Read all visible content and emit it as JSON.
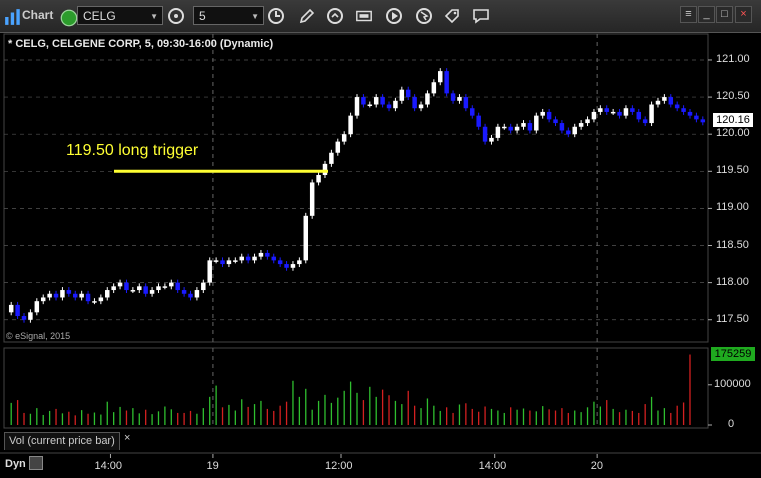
{
  "toolbar": {
    "app_label": "Chart",
    "symbol": "CELG",
    "interval": "5"
  },
  "chart": {
    "title": "* CELG, CELGENE CORP, 5, 09:30-16:00 (Dynamic)",
    "copyright": "© eSignal, 2015",
    "annotation": "119.50 long trigger",
    "last_price": "120.16",
    "last_volume": "175259",
    "study_label": "Vol (current price bar)",
    "study_close": "×",
    "footer_mode": "Dyn",
    "colors": {
      "up": "#ffffff",
      "down": "#1a1aff",
      "trigger": "#ffff33",
      "vol_up": "#2fbf2f",
      "vol_down": "#d42020",
      "grid": "#555555"
    }
  },
  "chart_data": {
    "type": "candlestick",
    "y_ticks": [
      "121.00",
      "120.50",
      "120.00",
      "119.50",
      "119.00",
      "118.50",
      "118.00",
      "117.50"
    ],
    "ylim": [
      117.2,
      121.35
    ],
    "x_ticks": [
      "14:00",
      "19",
      "12:00",
      "14:00",
      "20"
    ],
    "trigger_level": 119.5,
    "vol_ticks": [
      "100000",
      "0"
    ],
    "vol_max": 175259,
    "closes": [
      117.7,
      117.55,
      117.5,
      117.6,
      117.75,
      117.8,
      117.85,
      117.8,
      117.9,
      117.85,
      117.8,
      117.85,
      117.75,
      117.75,
      117.8,
      117.9,
      117.95,
      118.0,
      117.9,
      117.9,
      117.95,
      117.85,
      117.9,
      117.95,
      117.95,
      118.0,
      117.9,
      117.85,
      117.8,
      117.9,
      118.0,
      118.3,
      118.3,
      118.25,
      118.3,
      118.3,
      118.35,
      118.3,
      118.35,
      118.4,
      118.35,
      118.3,
      118.25,
      118.2,
      118.25,
      118.3,
      118.9,
      119.35,
      119.45,
      119.6,
      119.75,
      119.9,
      120.0,
      120.25,
      120.5,
      120.4,
      120.4,
      120.5,
      120.4,
      120.35,
      120.45,
      120.6,
      120.5,
      120.35,
      120.4,
      120.55,
      120.7,
      120.85,
      120.55,
      120.45,
      120.5,
      120.35,
      120.25,
      120.1,
      119.9,
      119.95,
      120.1,
      120.1,
      120.05,
      120.1,
      120.15,
      120.05,
      120.25,
      120.3,
      120.2,
      120.15,
      120.05,
      120.0,
      120.1,
      120.15,
      120.2,
      120.3,
      120.35,
      120.3,
      120.3,
      120.25,
      120.35,
      120.3,
      120.2,
      120.15,
      120.4,
      120.45,
      120.5,
      120.4,
      120.35,
      120.3,
      120.25,
      120.2,
      120.16
    ],
    "volumes": [
      55000,
      62000,
      30000,
      28000,
      42000,
      25000,
      35000,
      40000,
      29000,
      33000,
      24000,
      37000,
      28000,
      31000,
      26000,
      58000,
      32000,
      45000,
      36000,
      42000,
      29000,
      38000,
      27000,
      34000,
      46000,
      39000,
      30000,
      30000,
      35000,
      28000,
      42000,
      70000,
      98000,
      44000,
      50000,
      36000,
      64000,
      45000,
      52000,
      60000,
      40000,
      35000,
      48000,
      58000,
      110000,
      70000,
      90000,
      38000,
      60000,
      75000,
      55000,
      68000,
      85000,
      108000,
      80000,
      62000,
      95000,
      70000,
      88000,
      74000,
      60000,
      52000,
      85000,
      48000,
      42000,
      66000,
      48000,
      35000,
      44000,
      30000,
      51000,
      54000,
      40000,
      33000,
      46000,
      40000,
      36000,
      30000,
      44000,
      38000,
      41000,
      36000,
      34000,
      47000,
      39000,
      36000,
      42000,
      30000,
      36000,
      32000,
      44000,
      58000,
      46000,
      62000,
      40000,
      32000,
      38000,
      35000,
      30000,
      52000,
      70000,
      36000,
      42000,
      30000,
      48000,
      56000,
      175259
    ]
  }
}
